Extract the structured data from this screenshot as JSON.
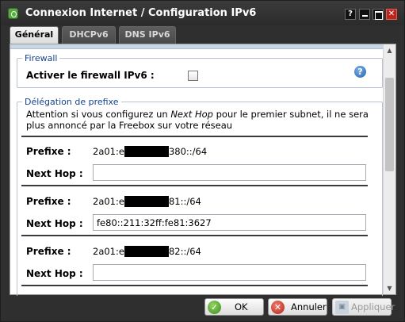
{
  "window": {
    "title": "Connexion Internet / Configuration IPv6",
    "controls": {
      "help": "?",
      "close": "✕"
    }
  },
  "tabs": [
    {
      "label": "Général",
      "active": true
    },
    {
      "label": "DHCPv6",
      "active": false
    },
    {
      "label": "DNS IPv6",
      "active": false
    }
  ],
  "firewall": {
    "legend": "Firewall",
    "enable_label": "Activer le firewall IPv6 :",
    "enabled": false,
    "help_glyph": "?"
  },
  "delegation": {
    "legend": "Délégation de prefixe",
    "note_before": "Attention si vous configurez un ",
    "note_em": "Next Hop",
    "note_after": " pour le premier subnet, il ne sera plus annoncé par la Freebox sur votre réseau",
    "prefix_label": "Prefixe :",
    "nexthop_label": "Next Hop :",
    "entries": [
      {
        "prefix_start": "2a01:e",
        "prefix_end": "380::/64",
        "next_hop": ""
      },
      {
        "prefix_start": "2a01:e",
        "prefix_end": "81::/64",
        "next_hop": "fe80::211:32ff:fe81:3627"
      },
      {
        "prefix_start": "2a01:e",
        "prefix_end": "82::/64",
        "next_hop": ""
      }
    ]
  },
  "buttons": {
    "ok": {
      "label": "OK",
      "enabled": true
    },
    "cancel": {
      "label": "Annuler",
      "enabled": true
    },
    "apply": {
      "label": "Appliquer",
      "enabled": false
    }
  },
  "scrollbar": {
    "up_glyph": "▲",
    "down_glyph": "▼"
  },
  "colors": {
    "titlebar": "#2f2f2f",
    "legend_text": "#15428b",
    "close_button": "#b8261e",
    "ok_icon": "#3a8b1c",
    "cancel_icon": "#b3261b",
    "help_icon": "#2561ab"
  }
}
